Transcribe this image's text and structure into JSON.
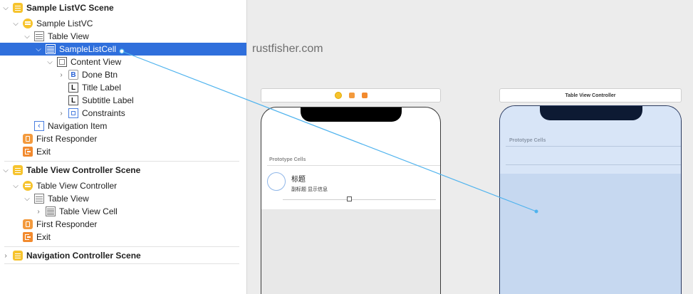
{
  "outline": {
    "rows": [
      {
        "label": "Sample ListVC Scene",
        "icon": "scene-icon",
        "indent": 0,
        "chevron": "down",
        "bold": true
      },
      {
        "label": "Sample ListVC",
        "icon": "view-controller-icon",
        "indent": 1,
        "chevron": "down"
      },
      {
        "label": "Table View",
        "icon": "table-view-icon",
        "indent": 2,
        "chevron": "down"
      },
      {
        "label": "SampleListCell",
        "icon": "table-cell-icon",
        "indent": 3,
        "chevron": "down",
        "selected": true
      },
      {
        "label": "Content View",
        "icon": "content-view-icon",
        "indent": 4,
        "chevron": "down"
      },
      {
        "label": "Done Btn",
        "icon": "button-icon",
        "indent": 5,
        "chevron": "right"
      },
      {
        "label": "Title Label",
        "icon": "label-icon",
        "indent": 5,
        "chevron": "none"
      },
      {
        "label": "Subtitle Label",
        "icon": "label-icon",
        "indent": 5,
        "chevron": "none"
      },
      {
        "label": "Constraints",
        "icon": "constraints-icon",
        "indent": 5,
        "chevron": "right"
      },
      {
        "label": "Navigation Item",
        "icon": "navigation-item-icon",
        "indent": 3,
        "chevron": "none"
      },
      {
        "label": "First Responder",
        "icon": "first-responder-icon",
        "indent": 1,
        "chevron": "none"
      },
      {
        "label": "Exit",
        "icon": "exit-icon",
        "indent": 1,
        "chevron": "none"
      },
      {
        "label": "Table View Controller Scene",
        "icon": "scene-icon",
        "indent": 0,
        "chevron": "down",
        "bold": true
      },
      {
        "label": "Table View Controller",
        "icon": "view-controller-icon",
        "indent": 1,
        "chevron": "down"
      },
      {
        "label": "Table View",
        "icon": "table-view-icon",
        "indent": 2,
        "chevron": "down"
      },
      {
        "label": "Table View Cell",
        "icon": "table-cell-icon",
        "indent": 3,
        "chevron": "right"
      },
      {
        "label": "First Responder",
        "icon": "first-responder-icon",
        "indent": 1,
        "chevron": "none"
      },
      {
        "label": "Exit",
        "icon": "exit-icon",
        "indent": 1,
        "chevron": "none"
      },
      {
        "label": "Navigation Controller Scene",
        "icon": "scene-icon",
        "indent": 0,
        "chevron": "right",
        "bold": true
      }
    ]
  },
  "canvas": {
    "watermark": "rustfisher.com",
    "scene1": {
      "bar_icons": [
        "view-controller-dot-icon",
        "first-responder-dot-icon",
        "exit-dot-icon"
      ],
      "prototype_title": "Prototype Cells",
      "cell_title": "标题",
      "cell_subtitle": "副标题 显示信息"
    },
    "scene2": {
      "bar_title": "Table View Controller",
      "prototype_title": "Prototype Cells"
    }
  },
  "colors": {
    "selection": "#2f6fdc",
    "scene_icon": "#f6c32d",
    "responder_icon": "#f39a3d",
    "connection_line": "#4fb3ee",
    "selected_vc_fill": "#c9daf1"
  }
}
